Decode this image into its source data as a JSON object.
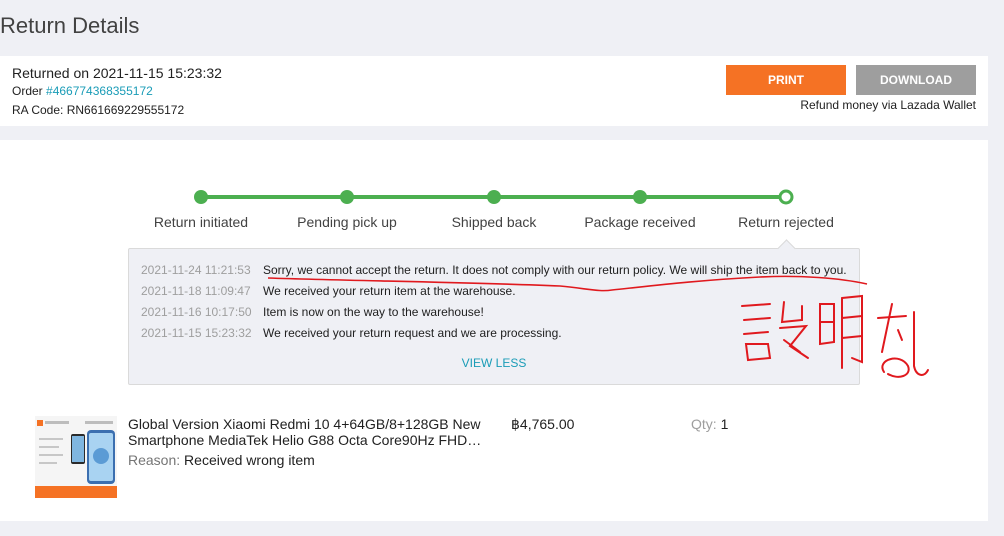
{
  "page": {
    "title": "Return Details"
  },
  "summary": {
    "returned_on": "Returned on 2021-11-15 15:23:32",
    "order_prefix": "Order ",
    "order_number": "#466774368355172",
    "ra_code": "RA Code: RN661669229555172",
    "print_label": "PRINT",
    "download_label": "DOWNLOAD",
    "refund_note": "Refund money via Lazada Wallet"
  },
  "progress": {
    "steps": [
      {
        "label": "Return initiated",
        "state": "done"
      },
      {
        "label": "Pending pick up",
        "state": "done"
      },
      {
        "label": "Shipped back",
        "state": "done"
      },
      {
        "label": "Package received",
        "state": "done"
      },
      {
        "label": "Return rejected",
        "state": "current"
      }
    ],
    "color": "#4caf50"
  },
  "history": {
    "entries": [
      {
        "time": "2021-11-24 11:21:53",
        "message": "Sorry, we cannot accept the return. It does not comply with our return policy. We will ship the item back to you."
      },
      {
        "time": "2021-11-18 11:09:47",
        "message": "We received your return item at the warehouse."
      },
      {
        "time": "2021-11-16 10:17:50",
        "message": "Item is now on the way to the warehouse!"
      },
      {
        "time": "2021-11-15 15:23:32",
        "message": "We received your return request and we are processing."
      }
    ],
    "view_less": "VIEW LESS"
  },
  "annotation": {
    "handwritten_text": "設明なし",
    "color": "#e0191e"
  },
  "product": {
    "title": "Global Version Xiaomi Redmi 10 4+64GB/8+128GB New Smartphone MediaTek Helio G88 Octa Core90Hz FHD…",
    "price": "฿4,765.00",
    "qty_label": "Qty:",
    "qty_value": "1",
    "reason_label": "Reason:",
    "reason_value": "Received wrong item",
    "image_banner_left": "Global Version",
    "image_banner_right": "Redmi 10"
  },
  "colors": {
    "accent": "#f57224",
    "link": "#1a9cb7",
    "success": "#4caf50",
    "disabled": "#9e9e9e"
  }
}
